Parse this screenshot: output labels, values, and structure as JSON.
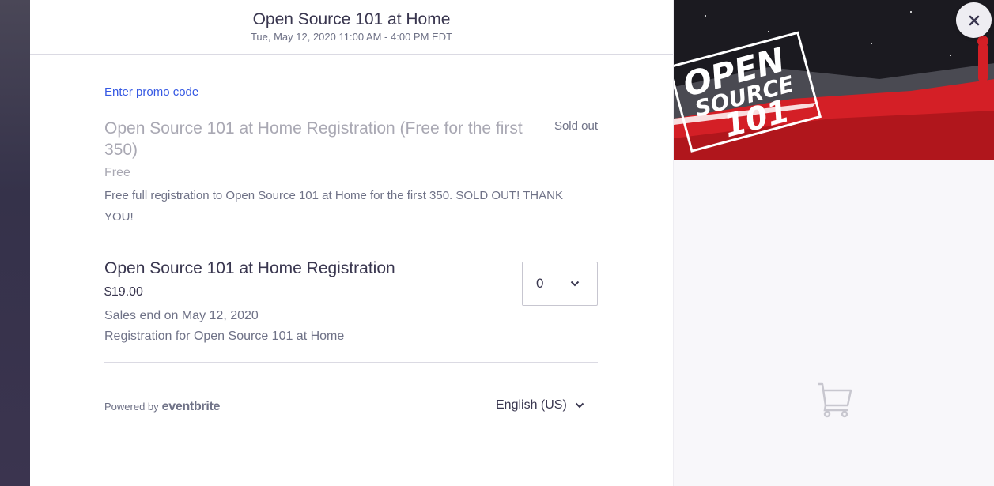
{
  "event": {
    "title": "Open Source 101 at Home",
    "datetime": "Tue, May 12, 2020 11:00 AM - 4:00 PM EDT"
  },
  "promo_link": "Enter promo code",
  "tickets": [
    {
      "name": "Open Source 101 at Home Registration (Free for the first 350)",
      "status": "Sold out",
      "price": "Free",
      "description": "Free full registration to Open Source 101 at Home for the first 350. SOLD OUT! THANK YOU!"
    },
    {
      "name": "Open Source 101 at Home Registration",
      "price": "$19.00",
      "sales_end": "Sales end on May 12, 2020",
      "description": "Registration for Open Source 101 at Home",
      "quantity": "0"
    }
  ],
  "footer": {
    "powered_by": "Powered by",
    "brand": "eventbrite",
    "language": "English (US)"
  },
  "banner": {
    "logo_line1": "OPEN",
    "logo_line2": "SOURCE",
    "logo_line3": "101"
  },
  "icons": {
    "close": "close-icon",
    "cart": "shopping-cart-icon",
    "chevron": "chevron-down-icon"
  },
  "colors": {
    "link": "#3659e3",
    "primary_text": "#39364f",
    "secondary_text": "#6f7287",
    "disabled_text": "#a9a8b3",
    "banner_red": "#d41f26"
  }
}
